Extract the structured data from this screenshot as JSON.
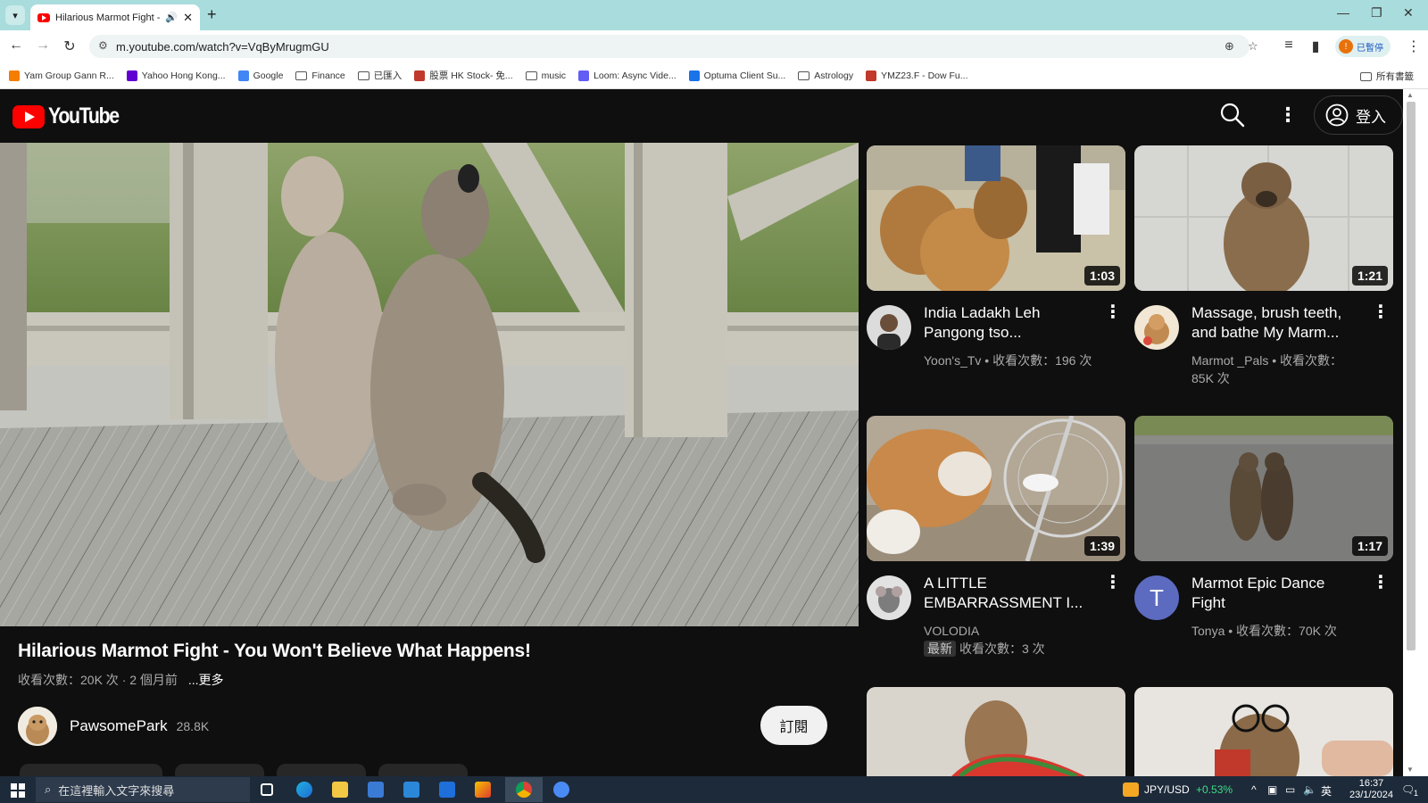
{
  "browser": {
    "tab_title": "Hilarious Marmot Fight - Y",
    "url": "m.youtube.com/watch?v=VqByMrugmGU",
    "paused_label": "已暫停",
    "profile_initial": "!",
    "bookmarks": [
      {
        "label": "Yam Group Gann R...",
        "icon": "blogger-icon",
        "color": "#f57d00"
      },
      {
        "label": "Yahoo Hong Kong...",
        "icon": "yahoo-icon",
        "color": "#6001d2"
      },
      {
        "label": "Google",
        "icon": "google-icon",
        "color": "#4285f4"
      },
      {
        "label": "Finance",
        "icon": "folder-icon"
      },
      {
        "label": "已匯入",
        "icon": "folder-icon"
      },
      {
        "label": "股票 HK Stock- 免...",
        "icon": "stock-icon",
        "color": "#c0392b"
      },
      {
        "label": "music",
        "icon": "folder-icon"
      },
      {
        "label": "Loom: Async Vide...",
        "icon": "loom-icon",
        "color": "#625df5"
      },
      {
        "label": "Optuma Client Su...",
        "icon": "optuma-icon",
        "color": "#1a73e8"
      },
      {
        "label": "Astrology",
        "icon": "folder-icon"
      },
      {
        "label": "YMZ23.F - Dow Fu...",
        "icon": "yahoo-finance-icon",
        "color": "#c0392b"
      }
    ],
    "all_bookmarks_label": "所有書籤"
  },
  "youtube": {
    "logo_text": "YouTube",
    "signin_label": "登入",
    "video": {
      "title": "Hilarious Marmot Fight - You Won't Believe What Happens!",
      "meta": "收看次數：20K 次 · 2 個月前",
      "more_label": "...更多",
      "channel_name": "PawsomePark",
      "channel_subs": "28.8K",
      "subscribe_label": "訂閱"
    },
    "suggestions": [
      {
        "duration": "1:03",
        "title": "India Ladakh Leh Pangong tso...",
        "meta": "Yoon's_Tv • 收看次數：196 次"
      },
      {
        "duration": "1:21",
        "title": "Massage, brush teeth, and bathe My Marm...",
        "meta": "Marmot _Pals • 收看次數：85K 次"
      },
      {
        "duration": "1:39",
        "title": "A LITTLE EMBARRASSMENT I...",
        "channel": "VOLODIA",
        "badge": "最新",
        "views": "收看次數：3 次"
      },
      {
        "duration": "1:17",
        "title": "Marmot Epic Dance Fight",
        "meta": "Tonya • 收看次數：70K 次",
        "avatar_letter": "T"
      }
    ]
  },
  "taskbar": {
    "search_placeholder": "在這裡輸入文字來搜尋",
    "ticker": "JPY/USD",
    "ticker_change": "+0.53%",
    "ime": "英",
    "time": "16:37",
    "date": "23/1/2024",
    "notif_count": "1"
  }
}
